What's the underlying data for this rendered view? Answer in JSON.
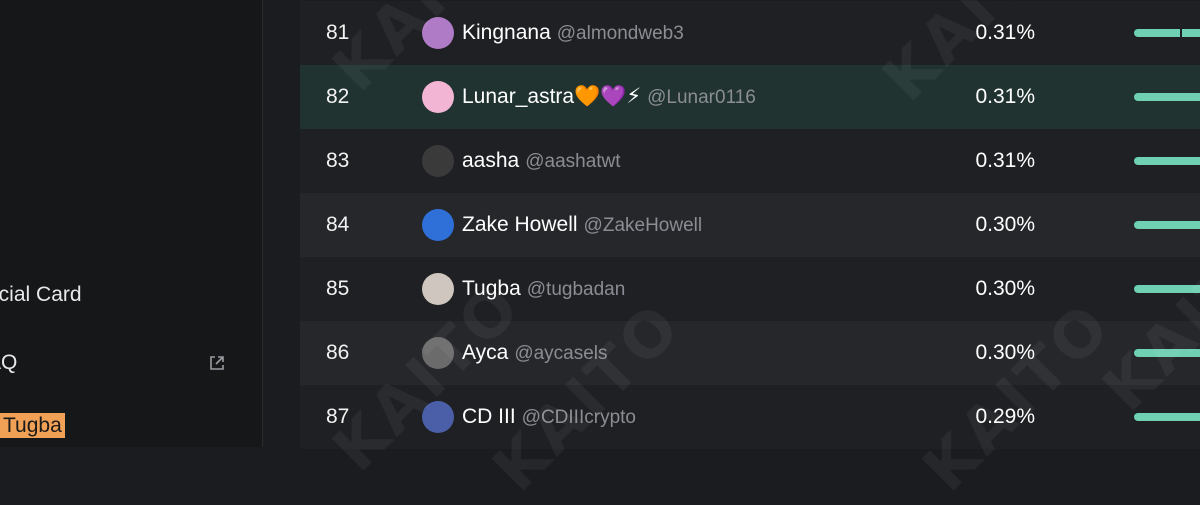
{
  "sidebar": {
    "social_card_label": "ocial Card",
    "faq_label": "AQ",
    "current_user_label": "Tugba"
  },
  "watermark": "KAITO",
  "rows": [
    {
      "rank": "81",
      "name": "Kingnana",
      "handle": "@almondweb3",
      "pct": "0.31%",
      "bar_fill": 1.0,
      "avatar_color": "#b07bc6"
    },
    {
      "rank": "82",
      "name": "Lunar_astra🧡💜⚡",
      "handle": "@Lunar0116",
      "pct": "0.31%",
      "bar_fill": 1.0,
      "avatar_color": "#f2b6d4"
    },
    {
      "rank": "83",
      "name": "aasha",
      "handle": "@aashatwt",
      "pct": "0.31%",
      "bar_fill": 1.0,
      "avatar_color": "#3a3a3a"
    },
    {
      "rank": "84",
      "name": "Zake Howell",
      "handle": "@ZakeHowell",
      "pct": "0.30%",
      "bar_fill": 1.0,
      "avatar_color": "#2f6fd8"
    },
    {
      "rank": "85",
      "name": "Tugba",
      "handle": "@tugbadan",
      "pct": "0.30%",
      "bar_fill": 1.0,
      "avatar_color": "#cfc7bf"
    },
    {
      "rank": "86",
      "name": "Ayca",
      "handle": "@aycasels",
      "pct": "0.30%",
      "bar_fill": 1.0,
      "avatar_color": "#6b6b6b"
    },
    {
      "rank": "87",
      "name": "CD III",
      "handle": "@CDIIIcrypto",
      "pct": "0.29%",
      "bar_fill": 1.0,
      "avatar_color": "#4a5fa8"
    }
  ],
  "colors": {
    "bar": "#6fd0b2",
    "highlight_row": "#203330",
    "user_tag": "#f0a155"
  }
}
